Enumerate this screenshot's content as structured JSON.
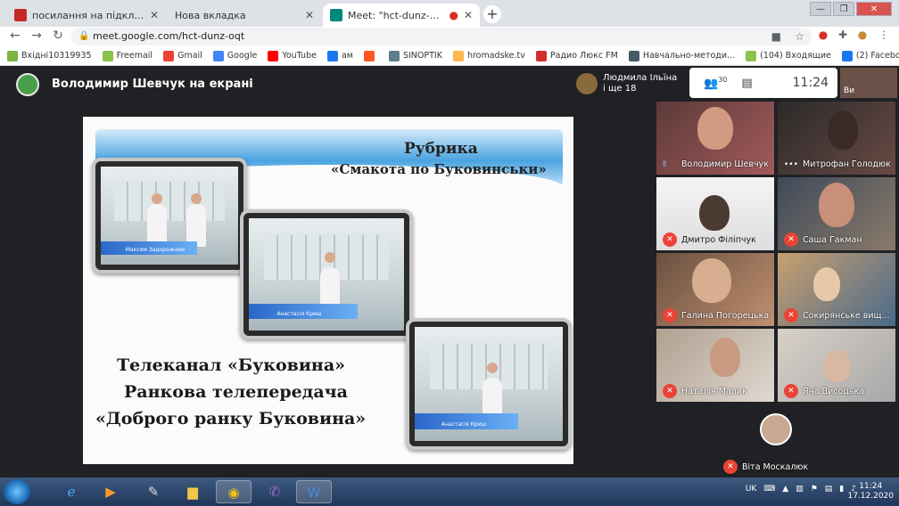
{
  "browser": {
    "tabs": [
      {
        "title": "посилання на підключення • пош",
        "favicon_color": "#d93025",
        "active": false
      },
      {
        "title": "Нова вкладка",
        "favicon_color": "",
        "active": false
      },
      {
        "title": "Meet: \"hct-dunz-oqt\"",
        "favicon_color": "#00897b",
        "active": true
      }
    ],
    "new_tab_label": "+",
    "url": "meet.google.com/hct-dunz-oqt",
    "bookmarks": [
      {
        "label": "Вхідні10319935",
        "color": "#7cb342"
      },
      {
        "label": "Freemail",
        "color": "#8bc34a"
      },
      {
        "label": "Gmail",
        "color": "#ea4335"
      },
      {
        "label": "Google",
        "color": "#4285f4"
      },
      {
        "label": "YouTube",
        "color": "#ff0000"
      },
      {
        "label": "ам",
        "color": "#1877f2"
      },
      {
        "label": "",
        "color": "#ff5722"
      },
      {
        "label": "SINOPTIK",
        "color": "#607d8b"
      },
      {
        "label": "hromadske.tv",
        "color": "#ffb74d"
      },
      {
        "label": "Радио Люкс FM",
        "color": "#d32f2f"
      },
      {
        "label": "Навчально-методи...",
        "color": "#455a64"
      },
      {
        "label": "(104) Входящие",
        "color": "#8bc34a"
      },
      {
        "label": "(2) Facebook",
        "color": "#1877f2"
      }
    ]
  },
  "meet": {
    "title": "Володимир Шевчук на екрані",
    "speaker_name": "Людмила Ільїна",
    "speaker_more": "і ще 18",
    "participants_count": "30",
    "time": "11:24",
    "top_thumb_name": "Ви",
    "participants": [
      {
        "name": "Володимир Шевчук",
        "status": "speaking"
      },
      {
        "name": "Митрофан Голодюк",
        "status": "dots"
      },
      {
        "name": "Дмитро Філіпчук",
        "status": "muted"
      },
      {
        "name": "Саша Гакман",
        "status": "muted"
      },
      {
        "name": "Галина Погорецька",
        "status": "muted"
      },
      {
        "name": "Сокирянське вищ...",
        "status": "muted"
      },
      {
        "name": "Наталія Малик",
        "status": "muted"
      },
      {
        "name": "Яна Висоцька",
        "status": "muted"
      },
      {
        "name": "Віта Москалюк",
        "status": "muted"
      }
    ]
  },
  "slide": {
    "rubric_line1": "Рубрика",
    "rubric_line2": "«Смакота по Буковинськи»",
    "line1": "Телеканал «Буковина»",
    "line2": "Ранкова телепередача",
    "line3": "«Доброго ранку Буковина»",
    "tv1_caption": "Максим Задорожнюк",
    "tv2_caption": "Анастасія Криш",
    "tv3_caption": "Анастасія Криш"
  },
  "taskbar": {
    "lang": "UK",
    "time": "11:24",
    "date": "17.12.2020"
  }
}
